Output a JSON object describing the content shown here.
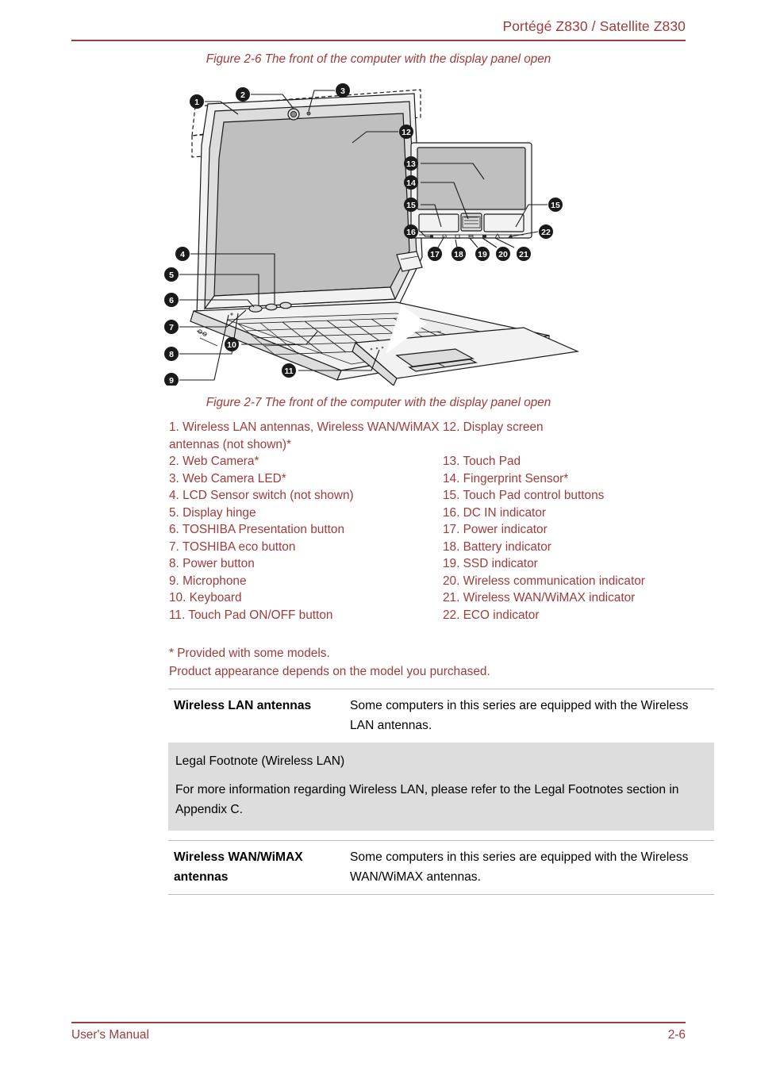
{
  "header": {
    "title": "Portégé Z830 / Satellite Z830",
    "rule_color": "#9e3b3b"
  },
  "figure_top": {
    "caption": "Figure 2-6 The front of the computer with the display panel open"
  },
  "figure_bottom": {
    "caption": "Figure 2-7 The front of the computer with the display panel open",
    "callouts": [
      "1",
      "2",
      "3",
      "4",
      "5",
      "6",
      "7",
      "8",
      "9",
      "10",
      "11",
      "12",
      "13",
      "14",
      "15",
      "15",
      "16",
      "17",
      "18",
      "19",
      "20",
      "21",
      "22"
    ]
  },
  "parts_list": {
    "left": [
      "1. Wireless LAN antennas, Wireless WAN/WiMAX antennas (not shown)*",
      "2. Web Camera*",
      "3. Web Camera LED*",
      "4. LCD Sensor switch (not shown)",
      "5. Display hinge",
      "6. TOSHIBA Presentation button",
      "7. TOSHIBA eco button",
      "8. Power button",
      "9. Microphone",
      "10. Keyboard",
      "11. Touch Pad ON/OFF button"
    ],
    "right": [
      "12. Display screen",
      "",
      "13. Touch Pad",
      "14. Fingerprint Sensor*",
      "15. Touch Pad control buttons",
      "16. DC IN indicator",
      "17. Power indicator",
      "18. Battery indicator",
      "19. SSD indicator",
      "20. Wireless communication indicator",
      "21. Wireless WAN/WiMAX indicator",
      "22. ECO indicator"
    ]
  },
  "notes": {
    "line1": "* Provided with some models.",
    "line2": "Product appearance depends on the model you purchased."
  },
  "definitions": {
    "wlan": {
      "term": "Wireless LAN antennas",
      "description": "Some computers in this series are equipped with the Wireless LAN antennas."
    },
    "wwan": {
      "term": "Wireless WAN/WiMAX antennas",
      "description": "Some computers in this series are equipped with the Wireless WAN/WiMAX antennas."
    }
  },
  "legal_footnote": {
    "title": "Legal Footnote (Wireless LAN)",
    "body": "For more information regarding Wireless LAN, please refer to the Legal Footnotes section in Appendix C.",
    "background": "#dddddd"
  },
  "footer": {
    "left": "User's Manual",
    "right": "2-6"
  },
  "colors": {
    "accent_red": "#9e3b3b",
    "body_text": "#000000",
    "rule_gray": "#bdbdbd"
  }
}
